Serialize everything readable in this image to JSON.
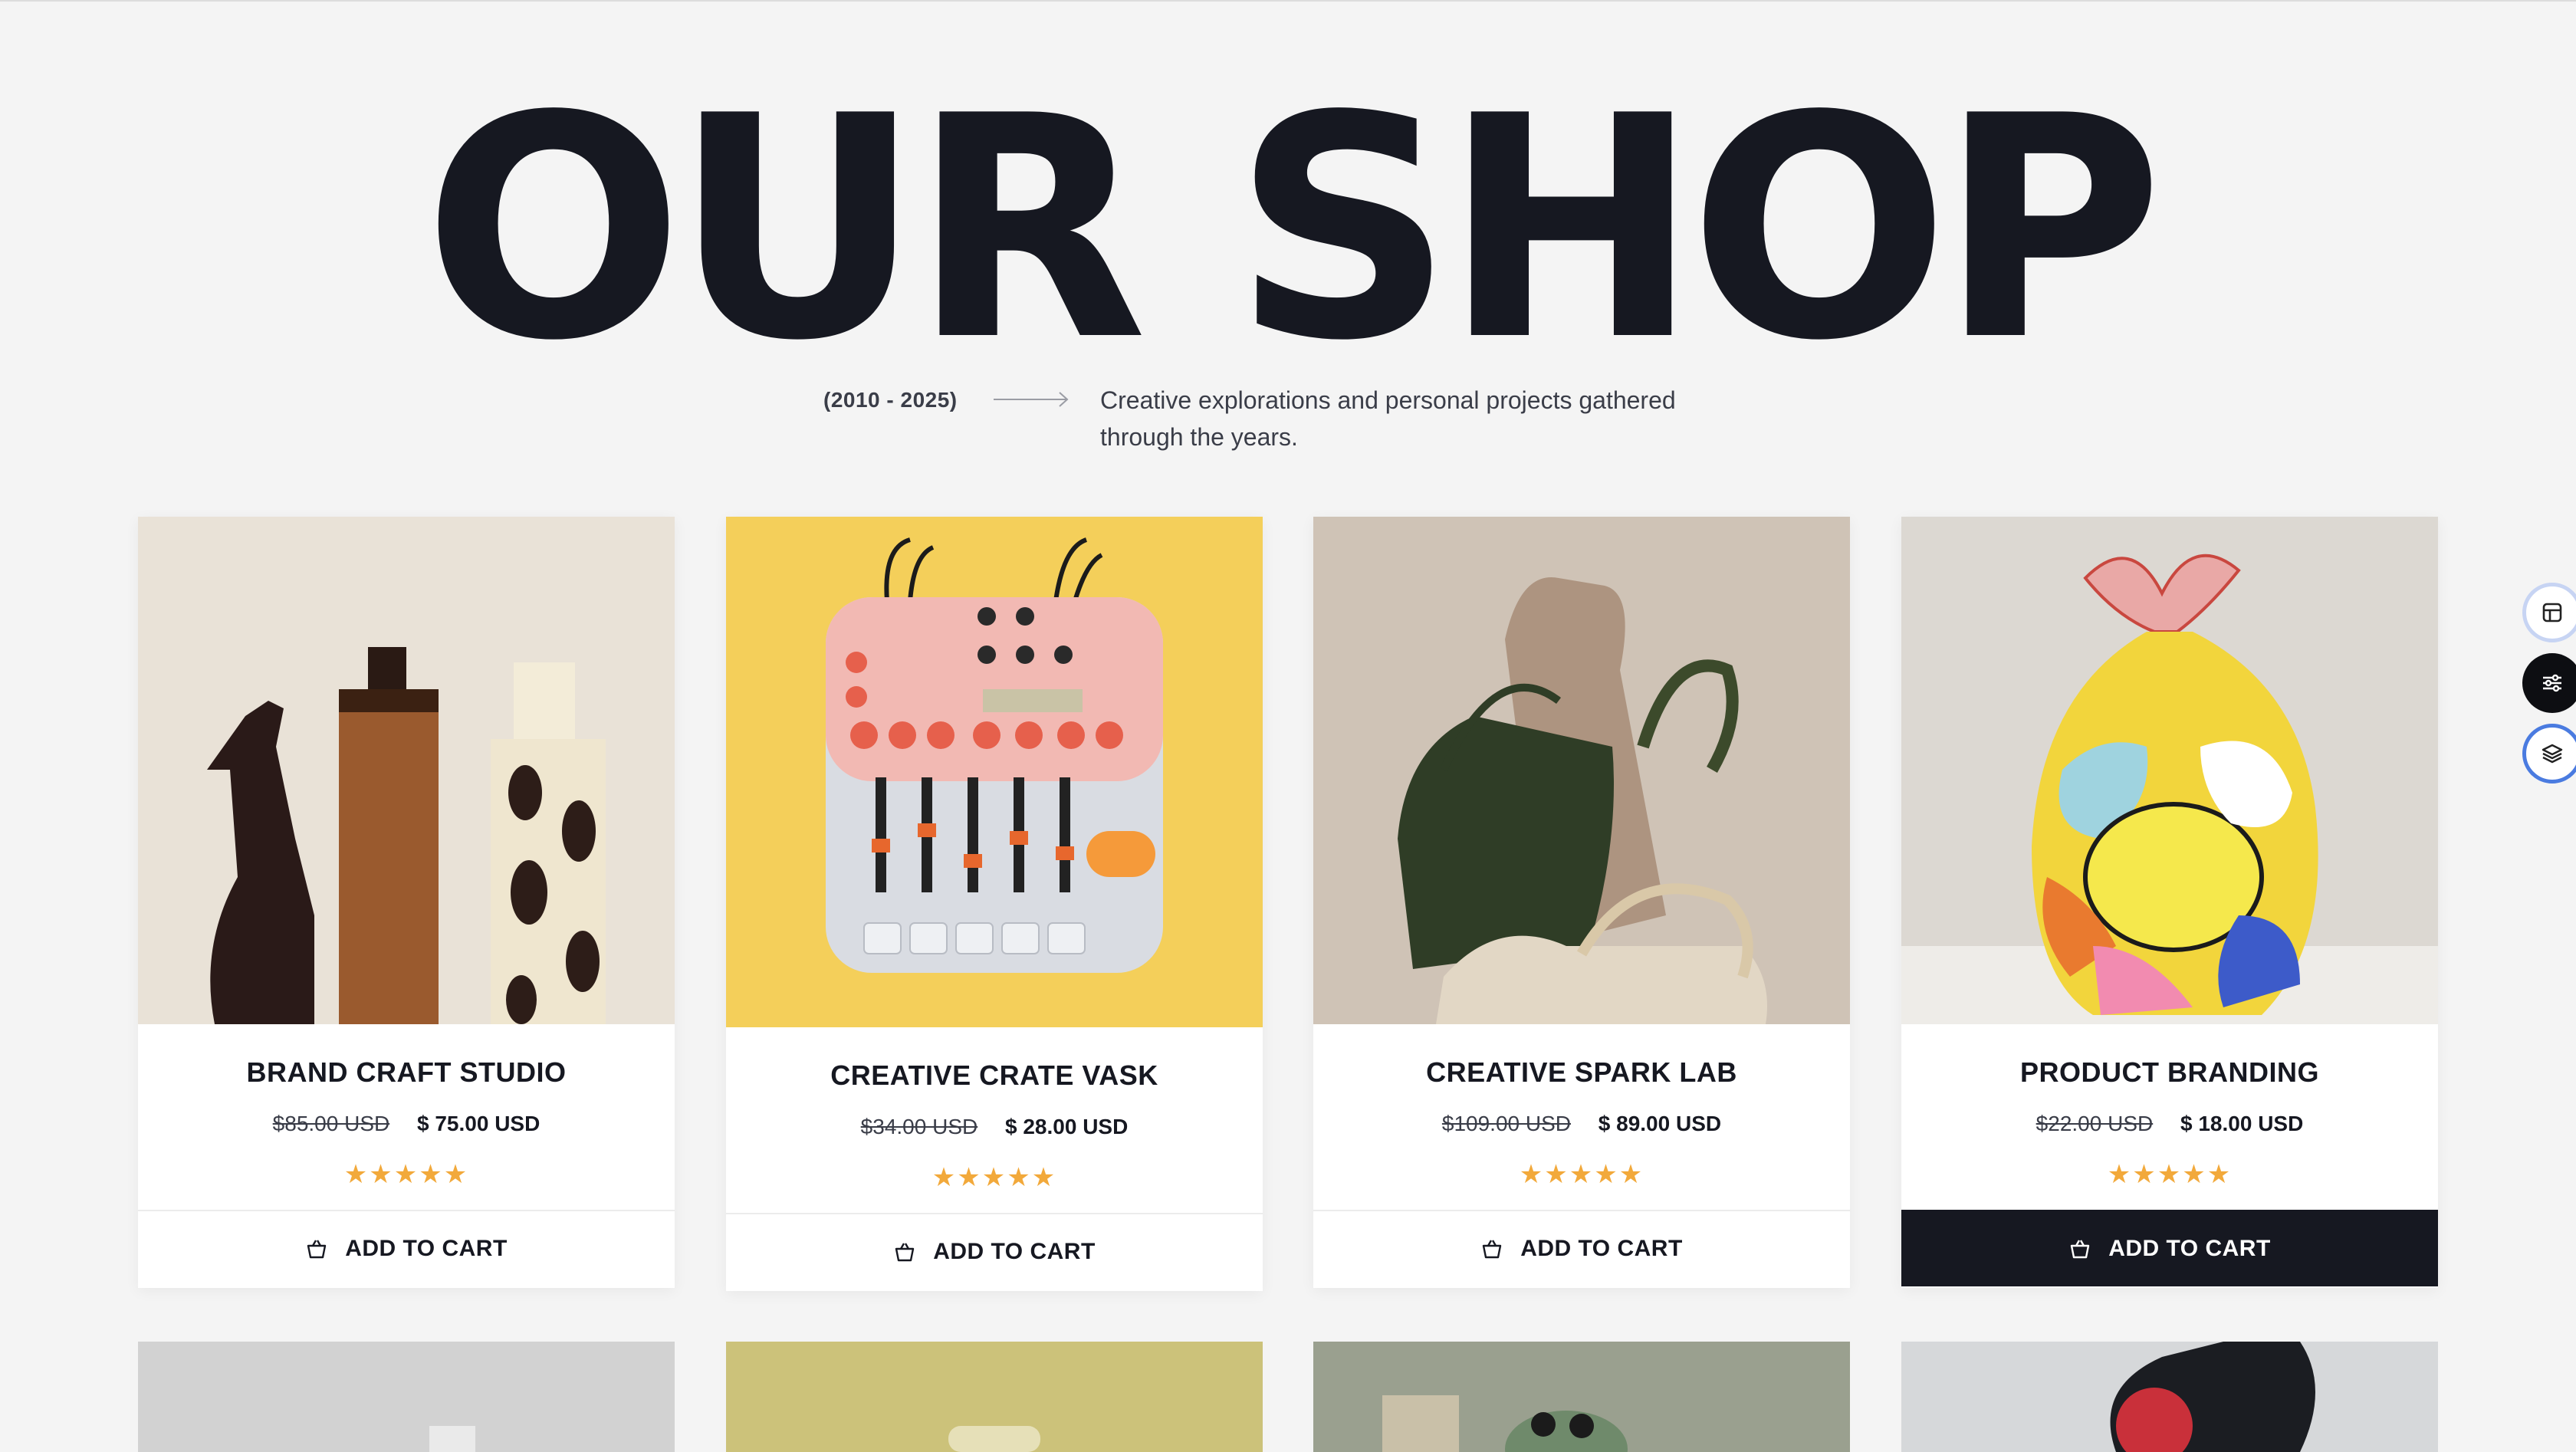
{
  "hero": {
    "title": "OUR SHOP",
    "years": "(2010 - 2025)",
    "description": "Creative explorations and personal projects gathered through the years."
  },
  "products": [
    {
      "title": "BRAND CRAFT STUDIO",
      "old_price": "$85.00 USD",
      "price": "$ 75.00 USD",
      "rating_stars": "★★★★★",
      "rating": 5,
      "cta": "ADD TO CART"
    },
    {
      "title": "CREATIVE CRATE VASK",
      "old_price": "$34.00 USD",
      "price": "$ 28.00 USD",
      "rating_stars": "★★★★★",
      "rating": 5,
      "cta": "ADD TO CART"
    },
    {
      "title": "CREATIVE SPARK LAB",
      "old_price": "$109.00 USD",
      "price": "$ 89.00 USD",
      "rating_stars": "★★★★★",
      "rating": 5,
      "cta": "ADD TO CART"
    },
    {
      "title": "PRODUCT BRANDING",
      "old_price": "$22.00 USD",
      "price": "$ 18.00 USD",
      "rating_stars": "★★★★★",
      "rating": 5,
      "cta": "ADD TO CART",
      "cta_active": true
    }
  ],
  "colors": {
    "page_bg": "#f4f4f4",
    "ink": "#161821",
    "star": "#f2a93b",
    "tool_accent": "#4a7be0"
  },
  "side_tools": [
    {
      "icon": "layout-icon"
    },
    {
      "icon": "sliders-icon"
    },
    {
      "icon": "layers-icon"
    }
  ]
}
